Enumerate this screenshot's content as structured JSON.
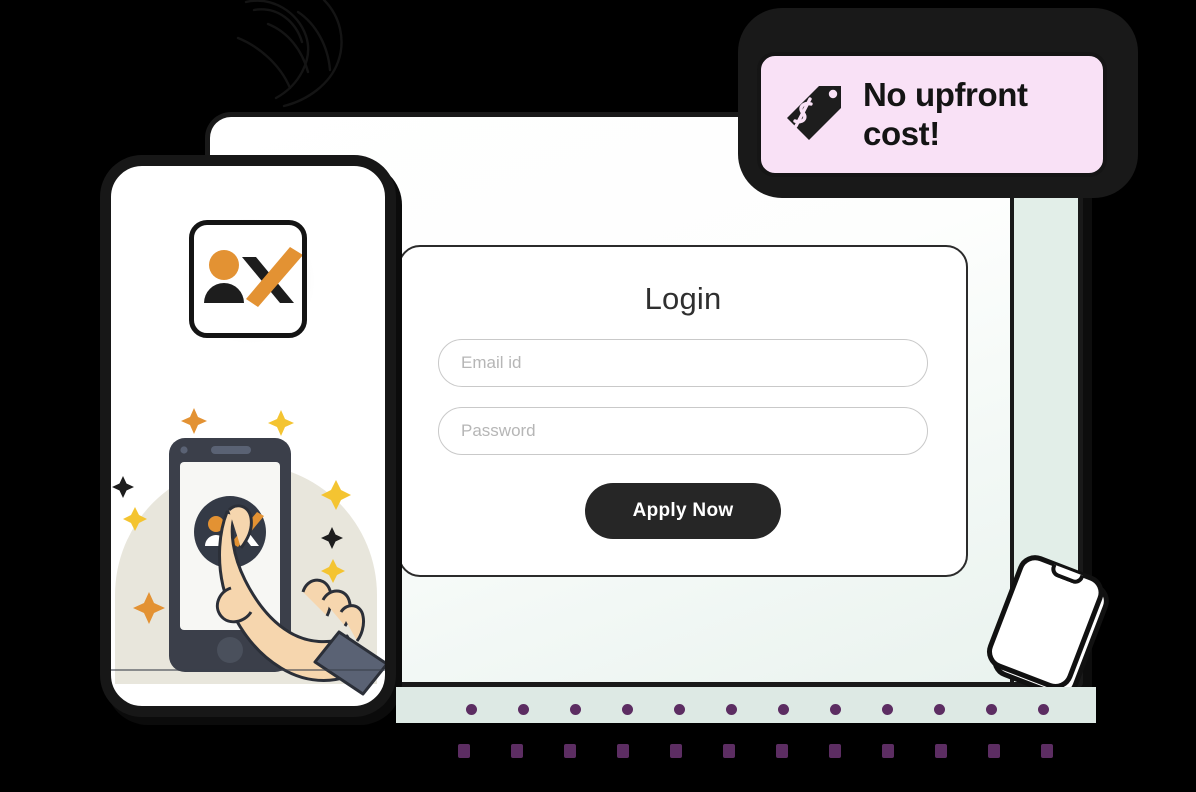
{
  "theme": {
    "page_background": "#000000",
    "panel_gradient_start": "#ffffff",
    "panel_gradient_end": "#e9f2ee",
    "panel_border": "#191919",
    "mint_strip": "#e2eee8",
    "mint_band": "#dde9e4",
    "badge_background": "#f9e1f6",
    "badge_border": "#151515",
    "dot_color": "#5c2d62",
    "accent_orange": "#e39233",
    "accent_yellow": "#f4c431",
    "illustration_beige": "#e8e6dc",
    "phone_body_dark": "#3b3f4a",
    "button_dark": "#262626",
    "text_dark": "#2f2f2f",
    "placeholder_gray": "#b6b6b6",
    "skin_tone": "#f6d6ae",
    "sleeve_gray": "#5a6274"
  },
  "badge": {
    "icon": "price-tag-icon",
    "line1": "No upfront",
    "line2": "cost!"
  },
  "login_card": {
    "title": "Login",
    "email": {
      "value": "",
      "placeholder": "Email id"
    },
    "password": {
      "value": "",
      "placeholder": "Password"
    },
    "submit_label": "Apply Now"
  },
  "phone_mockup": {
    "app_icon": "person-x-app-icon",
    "illustration": "hand-tapping-phone-illustration",
    "inner_phone_icon": "person-x-circle-icon"
  },
  "mini_phone": {
    "name": "tilted-phone-outline"
  },
  "decorations": {
    "sketch": "scribble-sketch",
    "sparkles": [
      "orange-sparkle",
      "yellow-sparkle",
      "dark-sparkle"
    ],
    "dot_row_top_count": 12,
    "dot_row_bottom_count": 12
  }
}
